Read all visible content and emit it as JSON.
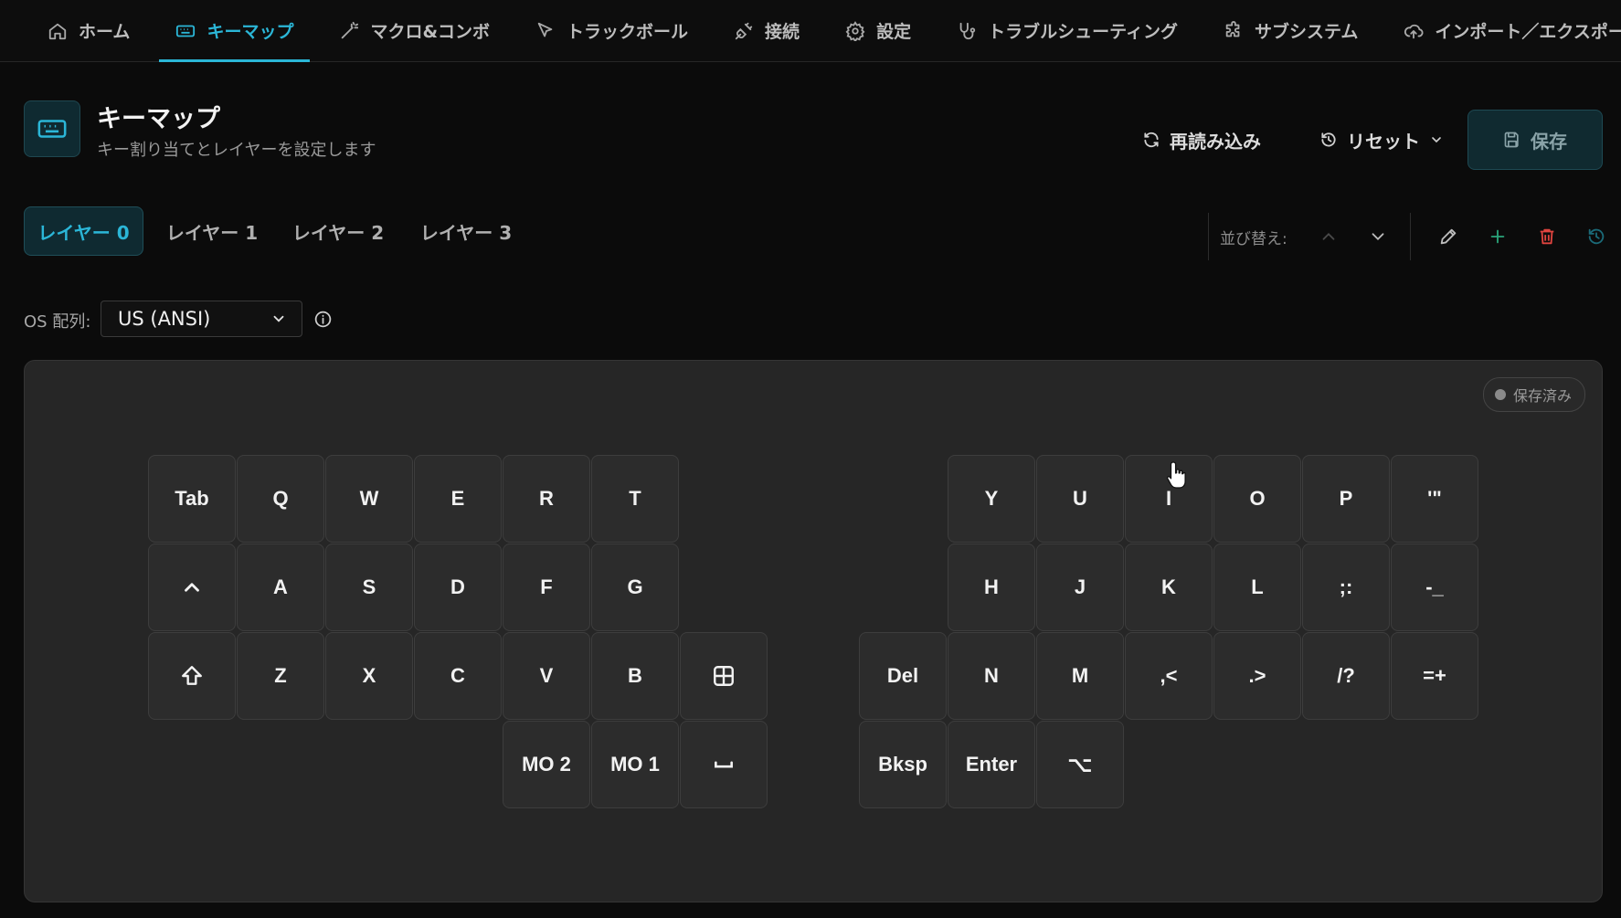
{
  "nav": {
    "items": [
      {
        "label": "ホーム",
        "icon": "home-icon",
        "active": false
      },
      {
        "label": "キーマップ",
        "icon": "keyboard-icon",
        "active": true
      },
      {
        "label": "マクロ&コンボ",
        "icon": "magic-wand-icon",
        "active": false
      },
      {
        "label": "トラックボール",
        "icon": "pointer-icon",
        "active": false
      },
      {
        "label": "接続",
        "icon": "plug-icon",
        "active": false
      },
      {
        "label": "設定",
        "icon": "gear-icon",
        "active": false
      },
      {
        "label": "トラブルシューティング",
        "icon": "stethoscope-icon",
        "active": false
      },
      {
        "label": "サブシステム",
        "icon": "puzzle-icon",
        "active": false
      },
      {
        "label": "インポート／エクスポート",
        "icon": "cloud-upload-icon",
        "active": false
      }
    ]
  },
  "header": {
    "title": "キーマップ",
    "subtitle": "キー割り当てとレイヤーを設定します",
    "reload_label": "再読み込み",
    "reset_label": "リセット",
    "save_label": "保存"
  },
  "layers": {
    "tabs": [
      "レイヤー 0",
      "レイヤー 1",
      "レイヤー 2",
      "レイヤー 3"
    ],
    "active": 0,
    "sort_label": "並び替え:"
  },
  "os_layout": {
    "label": "OS 配列:",
    "selected": "US (ANSI)"
  },
  "status": {
    "saved_label": "保存済み"
  },
  "keys": {
    "tab": "Tab",
    "q": "Q",
    "w": "W",
    "e": "E",
    "r": "R",
    "t": "T",
    "a": "A",
    "s": "S",
    "d": "D",
    "f": "F",
    "g": "G",
    "z": "Z",
    "x": "X",
    "c": "C",
    "v": "V",
    "b": "B",
    "mo2": "MO 2",
    "mo1": "MO 1",
    "y": "Y",
    "u": "U",
    "i": "I",
    "o": "O",
    "p": "P",
    "quote": "'\"",
    "h": "H",
    "j": "J",
    "k": "K",
    "l": "L",
    "semicolon": ";:",
    "minus": "-_",
    "del": "Del",
    "n": "N",
    "m": "M",
    "comma": ",<",
    "period": ".>",
    "slash": "/?",
    "equal": "=+",
    "bksp": "Bksp",
    "enter": "Enter",
    "alt": "⌥"
  },
  "colors": {
    "accent": "#2bb6d7",
    "add": "#2aa57a",
    "delete": "#e0443f"
  }
}
